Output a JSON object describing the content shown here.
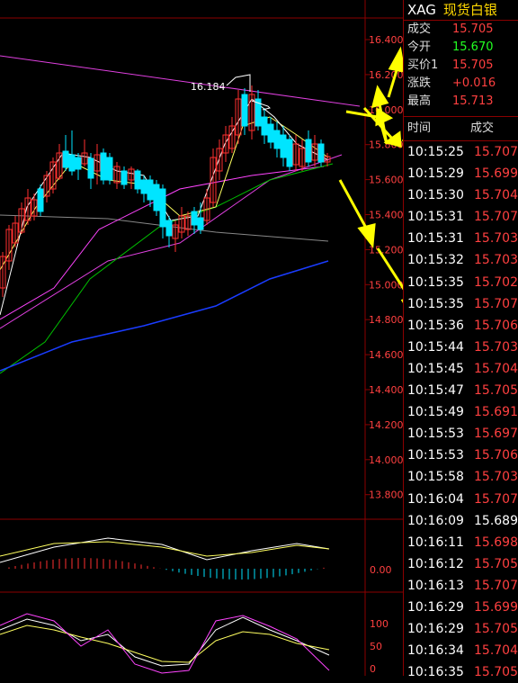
{
  "header": {
    "symbol": "XAG",
    "name": "现货白银"
  },
  "quote": [
    {
      "label": "成交",
      "value": "15.705",
      "color": "#ff4040"
    },
    {
      "label": "今开",
      "value": "15.670",
      "color": "#22ff22"
    },
    {
      "label": "买价1",
      "value": "15.705",
      "color": "#ff4040"
    },
    {
      "label": "涨跌",
      "value": "+0.016",
      "color": "#ff4040"
    },
    {
      "label": "最高",
      "value": "15.713",
      "color": "#ff4040"
    }
  ],
  "ticks_header": {
    "time": "时间",
    "price": "成交"
  },
  "ticks": [
    {
      "time": "10:15:25",
      "price": "15.707",
      "color": "#ff4040"
    },
    {
      "time": "10:15:29",
      "price": "15.699",
      "color": "#ff4040"
    },
    {
      "time": "10:15:30",
      "price": "15.704",
      "color": "#ff4040"
    },
    {
      "time": "10:15:31",
      "price": "15.707",
      "color": "#ff4040"
    },
    {
      "time": "10:15:31",
      "price": "15.703",
      "color": "#ff4040"
    },
    {
      "time": "10:15:32",
      "price": "15.703",
      "color": "#ff4040"
    },
    {
      "time": "10:15:35",
      "price": "15.702",
      "color": "#ff4040"
    },
    {
      "time": "10:15:35",
      "price": "15.707",
      "color": "#ff4040"
    },
    {
      "time": "10:15:36",
      "price": "15.706",
      "color": "#ff4040"
    },
    {
      "time": "10:15:44",
      "price": "15.703",
      "color": "#ff4040"
    },
    {
      "time": "10:15:45",
      "price": "15.704",
      "color": "#ff4040"
    },
    {
      "time": "10:15:47",
      "price": "15.705",
      "color": "#ff4040"
    },
    {
      "time": "10:15:49",
      "price": "15.691",
      "color": "#ff4040"
    },
    {
      "time": "10:15:53",
      "price": "15.697",
      "color": "#ff4040"
    },
    {
      "time": "10:15:53",
      "price": "15.706",
      "color": "#ff4040"
    },
    {
      "time": "10:15:58",
      "price": "15.703",
      "color": "#ff4040"
    },
    {
      "time": "10:16:04",
      "price": "15.707",
      "color": "#ff4040"
    },
    {
      "time": "10:16:09",
      "price": "15.689",
      "color": "#ffffff"
    },
    {
      "time": "10:16:11",
      "price": "15.698",
      "color": "#ff4040"
    },
    {
      "time": "10:16:12",
      "price": "15.705",
      "color": "#ff4040"
    },
    {
      "time": "10:16:13",
      "price": "15.707",
      "color": "#ff4040"
    },
    {
      "time": "10:16:29",
      "price": "15.699",
      "color": "#ff4040"
    },
    {
      "time": "10:16:29",
      "price": "15.705",
      "color": "#ff4040"
    },
    {
      "time": "10:16:34",
      "price": "15.704",
      "color": "#ff4040"
    },
    {
      "time": "10:16:35",
      "price": "15.705",
      "color": "#ff4040"
    }
  ],
  "price_axis": [
    "16.400",
    "16.200",
    "16.000",
    "15.800",
    "15.600",
    "15.400",
    "15.200",
    "15.000",
    "14.800",
    "14.600",
    "14.400",
    "14.200",
    "14.000",
    "13.800"
  ],
  "high_label": "16.184",
  "macd_axis": [
    "0.00"
  ],
  "kdj_axis": [
    "100",
    "50",
    "0"
  ],
  "colors": {
    "up": "#ff3030",
    "down": "#00e5ff",
    "ma5": "#ffffff",
    "ma10": "#ffff60",
    "ma20": "#ff44ff",
    "ma30": "#00c000",
    "ma60": "#1a3cff",
    "arrow": "#ffff00",
    "grid": "#8b0000"
  }
}
